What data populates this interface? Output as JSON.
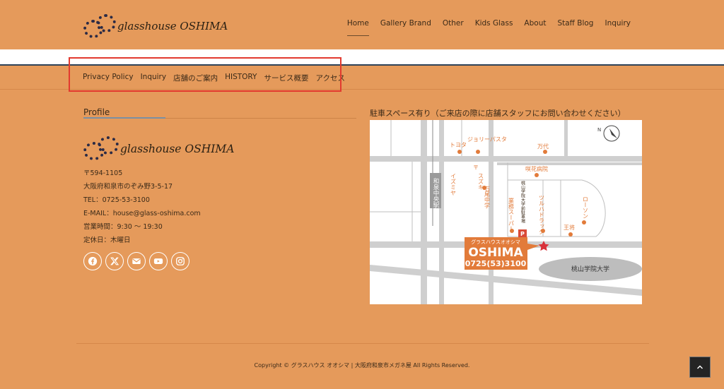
{
  "site": {
    "logo_text": "glasshouse OSHIMA"
  },
  "main_nav": [
    {
      "label": "Home"
    },
    {
      "label": "Gallery Brand"
    },
    {
      "label": "Other"
    },
    {
      "label": "Kids Glass"
    },
    {
      "label": "About"
    },
    {
      "label": "Staff Blog"
    },
    {
      "label": "Inquiry"
    }
  ],
  "sub_nav": [
    {
      "label": "Privacy Policy"
    },
    {
      "label": "Inquiry"
    },
    {
      "label": "店舗のご案内"
    },
    {
      "label": "HISTORY"
    },
    {
      "label": "サービス概要"
    },
    {
      "label": "アクセス"
    }
  ],
  "profile": {
    "title": "Profile",
    "logo_text": "glasshouse OSHIMA",
    "postal": "〒594-1105",
    "address": "大阪府和泉市のぞみ野3-5-17",
    "tel": "TEL：0725-53-3100",
    "email": "E-MAIL：house@glass-oshima.com",
    "hours": "営業時間：9:30 〜 19:30",
    "closed": "定休日：木曜日"
  },
  "socials": [
    {
      "icon": "facebook-icon"
    },
    {
      "icon": "x-icon"
    },
    {
      "icon": "mail-icon"
    },
    {
      "icon": "youtube-icon"
    },
    {
      "icon": "instagram-icon"
    }
  ],
  "map": {
    "caption": "駐車スペース有り（ご来店の際に店舗スタッフにお問い合わせください）",
    "labels": {
      "toyota": "トヨタ",
      "jolly_pasta": "ジョリーパスタ",
      "daiso": "万代",
      "sakihana": "咲花病院",
      "post": "〒",
      "suzuki": "スズキ",
      "ishio": "石尾中学",
      "izumiya": "イズミヤ",
      "izumi_chuo": "和泉中央駅",
      "gyomu": "業務スーパー",
      "momoyama_st": "桃山学院大学前駐車場",
      "tsuruha": "ツルハドラッグ",
      "lawson": "ローソン",
      "osho": "王将",
      "p": "P",
      "shop_kana": "グラスハウスオオシマ",
      "shop_name": "OSHIMA",
      "shop_tel": "0725(53)3100",
      "univ": "桃山学院大学",
      "north": "N"
    }
  },
  "footer": {
    "copyright": "Copyright © グラスハウス オオシマ | 大阪府和泉市メガネ屋 All Rights Reserved."
  },
  "colors": {
    "background": "#E59A5B",
    "highlight": "#e23a2f",
    "map_accent": "#e27b3a"
  }
}
